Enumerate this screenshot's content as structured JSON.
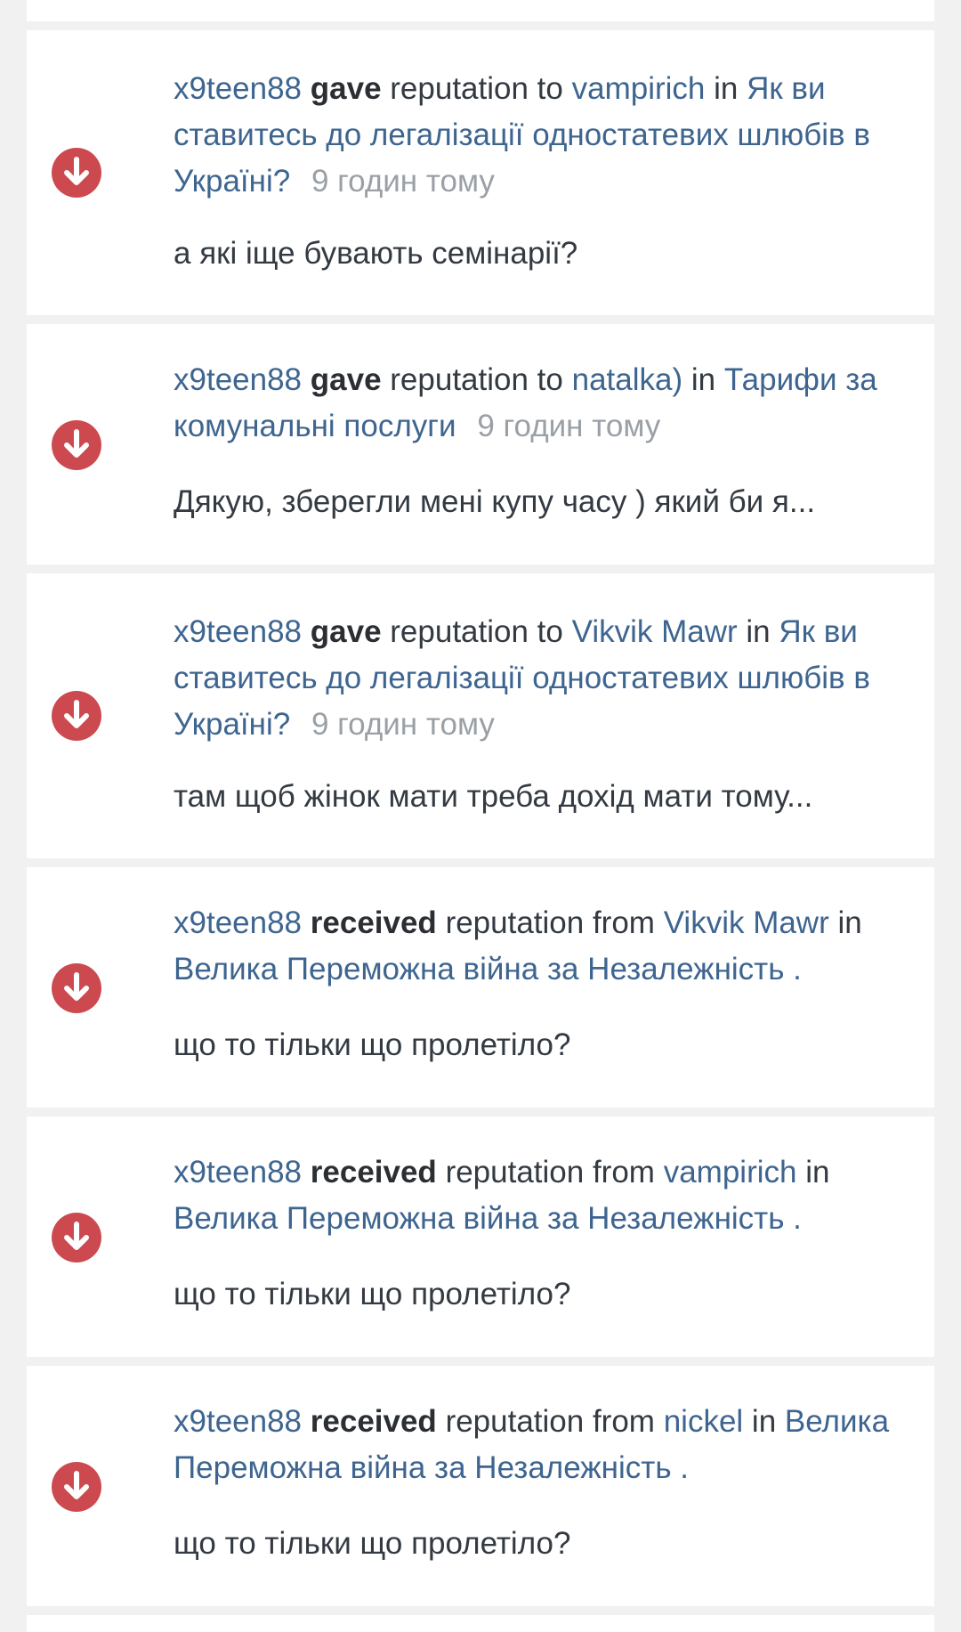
{
  "colors": {
    "link": "#3e6590",
    "icon_bg": "#cc4a4f",
    "time": "#9aa0a6",
    "text": "#333a42"
  },
  "items": [
    {
      "icon": "arrow-down-circle-icon",
      "user": "x9teen88",
      "action": "gave",
      "middle": "reputation to",
      "target": "vampirich",
      "in": "in",
      "topic": "Як ви ставитесь до легалізації одностатевих шлюбів в Україні?",
      "time": "9 годин тому",
      "excerpt": "а які іще бувають семінарії?"
    },
    {
      "icon": "arrow-down-circle-icon",
      "user": "x9teen88",
      "action": "gave",
      "middle": "reputation to",
      "target": "natalka)",
      "in": "in",
      "topic": "Тарифи за комунальні послуги",
      "time": "9 годин тому",
      "excerpt": "Дякую, зберегли мені купу часу ) який би я..."
    },
    {
      "icon": "arrow-down-circle-icon",
      "user": "x9teen88",
      "action": "gave",
      "middle": "reputation to",
      "target": "Vikvik Mawr",
      "in": "in",
      "topic": "Як ви ставитесь до легалізації одностатевих шлюбів в Україні?",
      "time": "9 годин тому",
      "excerpt": "там щоб жінок мати треба дохід мати тому..."
    },
    {
      "icon": "arrow-down-circle-icon",
      "user": "x9teen88",
      "action": "received",
      "middle": "reputation from",
      "target": "Vikvik Mawr",
      "in": "in",
      "topic": "Велика Переможна війна за Незалежність .",
      "time": "",
      "excerpt": "що то тільки що пролетіло?"
    },
    {
      "icon": "arrow-down-circle-icon",
      "user": "x9teen88",
      "action": "received",
      "middle": "reputation from",
      "target": "vampirich",
      "in": "in",
      "topic": "Велика Переможна війна за Незалежність .",
      "time": "",
      "excerpt": "що то тільки що пролетіло?"
    },
    {
      "icon": "arrow-down-circle-icon",
      "user": "x9teen88",
      "action": "received",
      "middle": "reputation from",
      "target": "nickel",
      "in": "in",
      "topic": "Велика Переможна війна за Незалежність .",
      "time": "",
      "excerpt": "що то тільки що пролетіло?"
    }
  ]
}
